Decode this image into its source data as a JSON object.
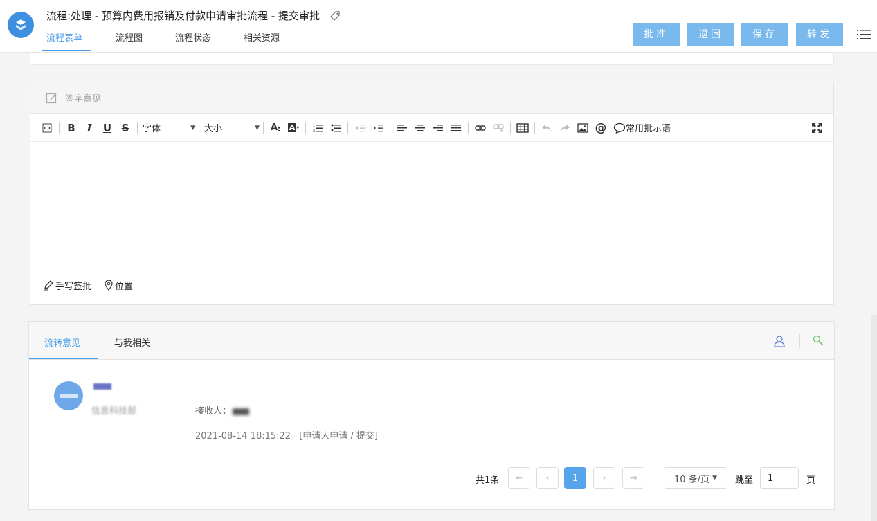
{
  "header": {
    "title": "流程:处理 - 预算内费用报销及付款申请审批流程 - 提交审批",
    "tabs": [
      "流程表单",
      "流程图",
      "流程状态",
      "相关资源"
    ],
    "buttons": [
      "批准",
      "退回",
      "保存",
      "转发"
    ],
    "accent_color": "#4a9eea",
    "button_color": "#7ab9ee"
  },
  "sign_panel": {
    "title": "签字意见",
    "font_label": "字体",
    "size_label": "大小",
    "common_phrases": "常用批示语",
    "footer": {
      "handwrite": "手写签批",
      "location": "位置"
    }
  },
  "flow_panel": {
    "tabs": [
      "流转意见",
      "与我相关"
    ],
    "record": {
      "dept": "信息科技部",
      "receiver_label": "接收人：",
      "time": "2021-08-14 18:15:22",
      "action": "[申请人申请 / 提交]"
    },
    "pager": {
      "total": "共1条",
      "current_page": "1",
      "page_size": "10 条/页",
      "jump_label": "跳至",
      "jump_value": "1",
      "page_word": "页"
    }
  }
}
